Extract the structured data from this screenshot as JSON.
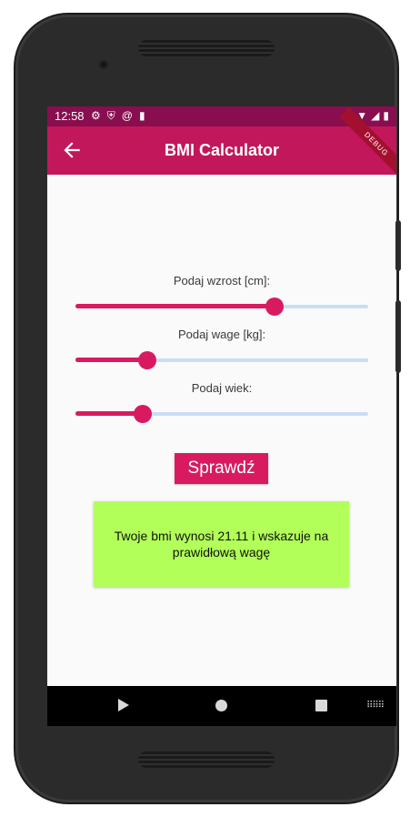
{
  "status_bar": {
    "time": "12:58",
    "icons": [
      "gear-icon",
      "shield-icon",
      "at-icon",
      "sd-card-icon"
    ],
    "right_icons": [
      "wifi-icon",
      "signal-icon",
      "battery-icon"
    ]
  },
  "app_bar": {
    "title": "BMI Calculator",
    "debug_banner": "DEBUG"
  },
  "form": {
    "height_label": "Podaj wzrost [cm]:",
    "weight_label": "Podaj wage [kg]:",
    "age_label": "Podaj wiek:",
    "height_slider_fraction": 0.68,
    "weight_slider_fraction": 0.245,
    "age_slider_fraction": 0.23
  },
  "check_button": "Sprawdź",
  "result_text": "Twoje bmi wynosi 21.11 i wskazuje na prawidłową wagę",
  "colors": {
    "status_bar": "#880e4f",
    "app_bar": "#c2185b",
    "accent": "#d81b60",
    "slider_track": "#c8def4",
    "result_background": "#b2ff59"
  },
  "nav_bar": {
    "icons": [
      "back-icon",
      "home-icon",
      "recents-icon",
      "keyboard-icon"
    ]
  }
}
